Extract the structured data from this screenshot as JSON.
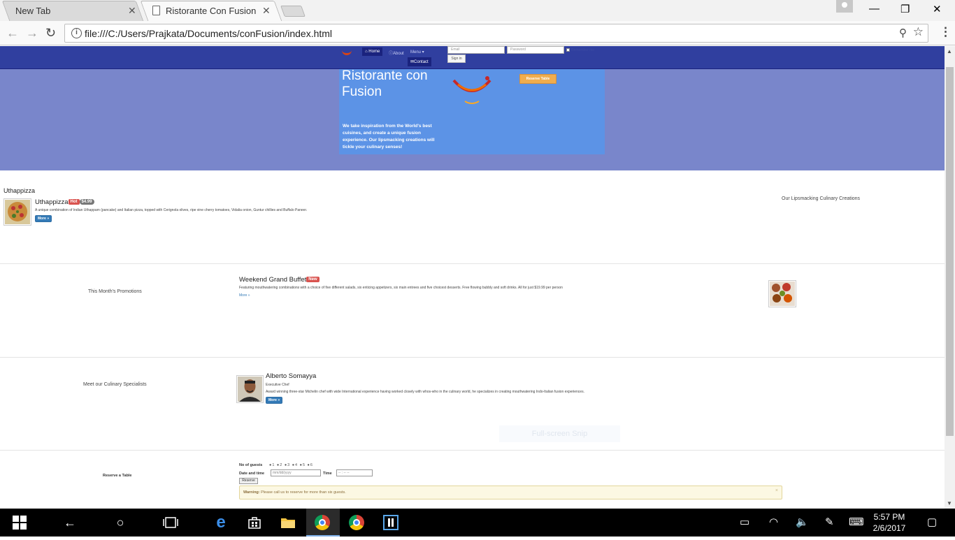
{
  "browser": {
    "tabs": [
      {
        "title": "New Tab",
        "close": "✕"
      },
      {
        "title": "Ristorante Con Fusion",
        "close": "✕"
      }
    ],
    "window_controls": {
      "minimize": "—",
      "maximize": "❐",
      "close": "✕"
    },
    "address": "file:///C:/Users/Prajkata/Documents/conFusion/index.html",
    "info_glyph": "i",
    "zoom_glyph": "⚲",
    "star_glyph": "☆",
    "menu_glyph": "⋮",
    "back_glyph": "←",
    "forward_glyph": "→",
    "reload_glyph": "↻"
  },
  "navbar": {
    "home": "Home",
    "about": "About",
    "menu": "Menu",
    "contact": "Contact",
    "email_placeholder": "Email",
    "password_placeholder": "Password",
    "remember": "Remember me",
    "signin": "Sign in"
  },
  "jumbotron": {
    "title": "Ristorante con Fusion",
    "text": "We take inspiration from the World's best cuisines, and create a unique fusion experience. Our lipsmacking creations will tickle your culinary senses!",
    "reserve_button": "Reserve Table"
  },
  "dish": {
    "heading": "Uthappizza",
    "name": "Uthappizza",
    "badge": "Hot",
    "price": "$4.99",
    "description": "A unique combination of Indian Uthappam (pancake) and Italian pizza, topped with Cerignola olives, ripe vine cherry tomatoes, Vidalia onion, Guntur chillies and Buffalo Paneer.",
    "more": "More »",
    "caption": "Our Lipsmacking Culinary Creations"
  },
  "promotion": {
    "caption": "This Month's Promotions",
    "name": "Weekend Grand Buffet",
    "badge": "New",
    "description": "Featuring mouthwatering combinations with a choice of five different salads, six enticing appetizers, six main entrees and five choicest desserts. Free flowing bubbly and soft drinks. All for just $19.99 per person",
    "more": "More »"
  },
  "leader": {
    "caption": "Meet our Culinary Specialists",
    "name": "Alberto Somayya",
    "designation": "Executive Chef",
    "description": "Award winning three-star Michelin chef with wide International experience having worked closely with whos-who in the culinary world, he specializes in creating mouthwatering Indo-Italian fusion experiences.",
    "more": "More »"
  },
  "reservation": {
    "caption": "Reserve a Table",
    "guests_label": "No of guests",
    "guest_options": "●1 ●2 ●3 ●4 ●5 ●6",
    "date_label": "Date and time",
    "date_placeholder": "mm/dd/yyyy",
    "time_label": "Time",
    "time_placeholder": "-- : -- --",
    "reserve_button": "Reserve",
    "warning_strong": "Warning:",
    "warning_text": "Please call us to reserve for more than six guests.",
    "warning_close": "×"
  },
  "overlay": {
    "snip": "Full-screen Snip"
  },
  "taskbar": {
    "clock_time": "5:57 PM",
    "clock_date": "2/6/2017",
    "back_glyph": "←",
    "cortana_glyph": "○"
  },
  "colors": {
    "navbar": "#303f9f",
    "jumbotron": "#7986cb",
    "jumbo_inner": "#5c93e6",
    "reserve_button": "#f0ad4e",
    "primary_button": "#337ab7",
    "badge_red": "#d9534f",
    "warning_bg": "#fcf8e3"
  }
}
